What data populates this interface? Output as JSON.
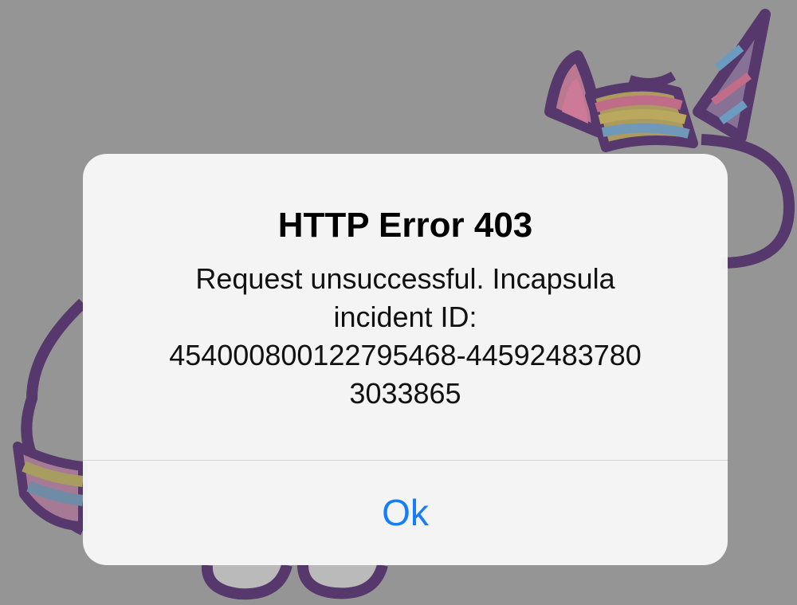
{
  "background": {
    "color": "#9b9b9b",
    "illustration": "unicorn-illustration"
  },
  "alert": {
    "title": "HTTP Error 403",
    "message_lines": [
      "Request unsuccessful. Incapsula",
      "incident ID:",
      "454000800122795468-44592483780",
      "3033865"
    ],
    "ok_label": "Ok",
    "accent_color": "#157efb"
  }
}
